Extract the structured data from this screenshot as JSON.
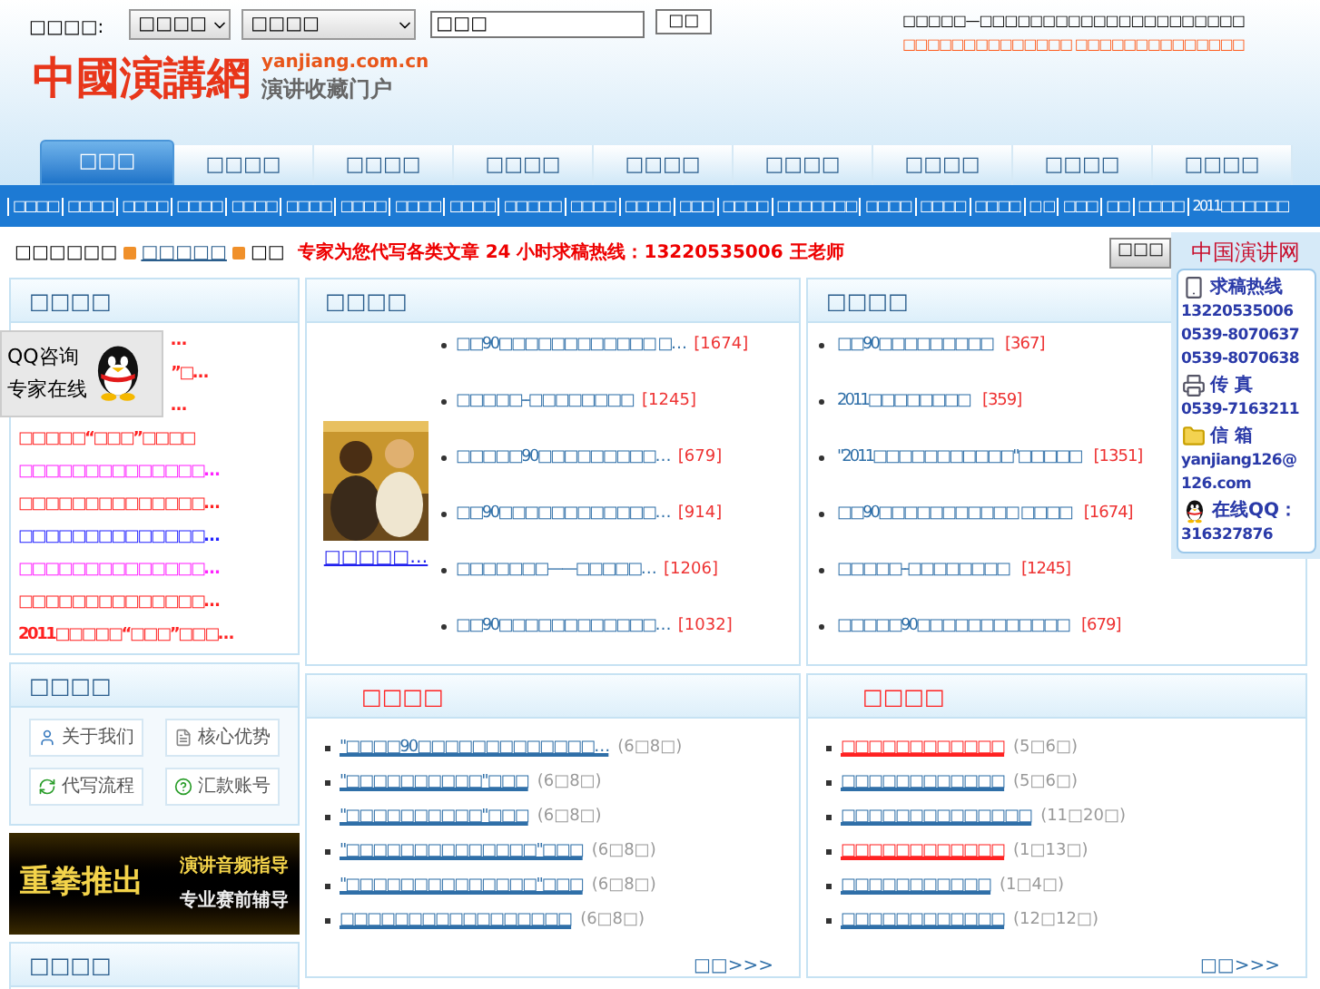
{
  "search": {
    "label": "□□□□:",
    "category": "□□□□",
    "subcategory": "□□□□",
    "value": "□□□",
    "button": "□□"
  },
  "notice": {
    "line1": "□□□□□—□□□□□□□□□□□□□□□□□□□□□",
    "line2": "□□□□□□□□□□□□□□ □□□□□□□□□□□□□□"
  },
  "logo": {
    "name": "中國演講網",
    "domain": "yanjiang.com.cn",
    "slogan": "演讲收藏门户"
  },
  "tabs": [
    {
      "label": "□□□",
      "selected": true
    },
    {
      "label": "□□□□",
      "selected": false
    },
    {
      "label": "□□□□",
      "selected": false
    },
    {
      "label": "□□□□",
      "selected": false
    },
    {
      "label": "□□□□",
      "selected": false
    },
    {
      "label": "□□□□",
      "selected": false
    },
    {
      "label": "□□□□",
      "selected": false
    },
    {
      "label": "□□□□",
      "selected": false
    },
    {
      "label": "□□□□",
      "selected": false
    }
  ],
  "subnav": [
    "□□□□",
    "□□□□",
    "□□□□",
    "□□□□",
    "□□□□",
    "□□□□",
    "□□□□",
    "□□□□",
    "□□□□",
    "□□□□□",
    "□□□□",
    "□□□□",
    "□□□",
    "□□□□",
    "□□□□□□□",
    "□□□□",
    "□□□□",
    "□□□□",
    "□ □",
    "□□□",
    "□□",
    "□□□□",
    "2011□□□□□□"
  ],
  "breadcrumb": {
    "prefix": "□□□□□□",
    "link": "□□□□□",
    "current": "□□",
    "hotline": "专家为您代写各类文章 24 小时求稿热线：13220535006 王老师",
    "button": "□□□"
  },
  "contact_panel": {
    "title": "中国演讲网",
    "entries": [
      {
        "kind": "phone",
        "text": "求稿热线"
      },
      {
        "kind": "line",
        "text": "13220535006"
      },
      {
        "kind": "line",
        "text": "0539-8070637"
      },
      {
        "kind": "line",
        "text": "0539-8070638"
      },
      {
        "kind": "fax",
        "text": "传 真"
      },
      {
        "kind": "line",
        "text": "0539-7163211"
      },
      {
        "kind": "mail",
        "text": "信 箱"
      },
      {
        "kind": "line",
        "text": "yanjiang126@"
      },
      {
        "kind": "line",
        "text": "126.com"
      },
      {
        "kind": "qq",
        "text": "在线QQ："
      },
      {
        "kind": "line",
        "text": "316327876"
      }
    ]
  },
  "qq_widget": {
    "line1": "QQ咨询",
    "line2": "专家在线"
  },
  "left_list": {
    "title": "□□□□",
    "items": [
      {
        "text": "…",
        "color": "#ff2222"
      },
      {
        "text": "”□…",
        "color": "#ff2222"
      },
      {
        "text": "…",
        "color": "#ff2222"
      },
      {
        "text": "□□□□□“□□□”□□□□",
        "color": "#ff2222"
      },
      {
        "text": "□□□□□□□□□□□□□□…",
        "color": "#ff22ff"
      },
      {
        "text": "□□□□□□□□□□□□□□…",
        "color": "#ff2222"
      },
      {
        "text": "□□□□□□□□□□□□□□…",
        "color": "#2222ff"
      },
      {
        "text": "□□□□□□□□□□□□□□…",
        "color": "#ff22ff"
      },
      {
        "text": "□□□□□□□□□□□□□□…",
        "color": "#ff2222"
      },
      {
        "text": "2011□□□□□“□□□”□□□…",
        "color": "#ff2222"
      }
    ]
  },
  "featured": {
    "title": "□□□□",
    "caption": "□□□□□…",
    "items": [
      {
        "text": "□□90□□□□□□□□□□□□ □…",
        "count": "[1674]"
      },
      {
        "text": "□□□□□--□□□□□□□□",
        "count": "[1245]"
      },
      {
        "text": "□□□□□90□□□□□□□□□…",
        "count": "[679]"
      },
      {
        "text": "□□90□□□□□□□□□□□□…",
        "count": "[914]"
      },
      {
        "text": "□□□□□□□——□□□□□…",
        "count": "[1206]"
      },
      {
        "text": "□□90□□□□□□□□□□□□…",
        "count": "[1032]"
      }
    ]
  },
  "hot": {
    "title": "□□□□",
    "items": [
      {
        "text": "□□90□□□□□□□□□",
        "count": "[367]"
      },
      {
        "text": "2011□□□□□□□□",
        "count": "[359]"
      },
      {
        "text": "\"2011□□□□□□□□□□□\"□□□□□",
        "count": "[1351]"
      },
      {
        "text": "□□90□□□□□□□□□□□ □□□□",
        "count": "[1674]"
      },
      {
        "text": "□□□□□--□□□□□□□□",
        "count": "[1245]"
      },
      {
        "text": "□□□□□90□□□□□□□□□□□□",
        "count": "[679]"
      }
    ]
  },
  "services": {
    "title": "□□□□",
    "buttons": [
      {
        "kind": "person",
        "label": "关于我们"
      },
      {
        "kind": "doc",
        "label": "核心优势"
      },
      {
        "kind": "flow",
        "label": "代写流程"
      },
      {
        "kind": "help",
        "label": "汇款账号"
      }
    ]
  },
  "banner": {
    "headline": "重拳推出",
    "line1": "演讲音频指导",
    "line2": "专业赛前辅导"
  },
  "left_bottom": {
    "title": "□□□□"
  },
  "news_a": {
    "title": "□□□□",
    "more": "□□>>>",
    "items": [
      {
        "text": "\"□□□□90□□□□□□□□□□□□□…",
        "date": "(6□8□)",
        "color": "#2f6fa8"
      },
      {
        "text": "\"□□□□□□□□□□\"□□□",
        "date": "(6□8□)",
        "color": "#2f6fa8"
      },
      {
        "text": "\"□□□□□□□□□□\"□□□",
        "date": "(6□8□)",
        "color": "#2f6fa8"
      },
      {
        "text": "\"□□□□□□□□□□□□□□\"□□□",
        "date": "(6□8□)",
        "color": "#2f6fa8"
      },
      {
        "text": "\"□□□□□□□□□□□□□□\"□□□",
        "date": "(6□8□)",
        "color": "#2f6fa8"
      },
      {
        "text": "□□□□□□□□□□□□□□□□□",
        "date": "(6□8□)",
        "color": "#2f6fa8"
      }
    ]
  },
  "news_b": {
    "title": "□□□□",
    "more": "□□>>>",
    "items": [
      {
        "text": "□□□□□□□□□□□□",
        "date": "(5□6□)",
        "color": "#ff2222"
      },
      {
        "text": "□□□□□□□□□□□□",
        "date": "(5□6□)",
        "color": "#2f6fa8"
      },
      {
        "text": "□□□□□□□□□□□□□□",
        "date": "(11□20□)",
        "color": "#2f6fa8"
      },
      {
        "text": "□□□□□□□□□□□□",
        "date": "(1□13□)",
        "color": "#ff2222"
      },
      {
        "text": "□□□□□□□□□□□",
        "date": "(1□4□)",
        "color": "#2f6fa8"
      },
      {
        "text": "□□□□□□□□□□□□",
        "date": "(12□12□)",
        "color": "#2f6fa8"
      }
    ]
  }
}
